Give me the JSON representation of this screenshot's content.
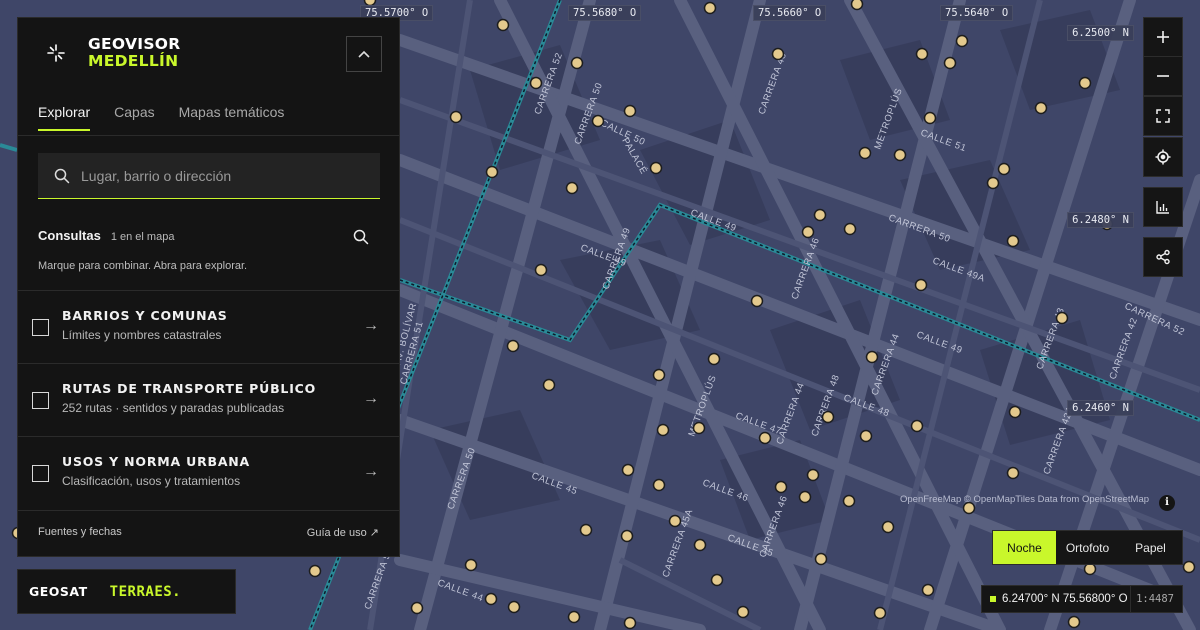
{
  "app": {
    "title_line1": "GEOVISOR",
    "title_line2": "MEDELLÍN",
    "collapse_icon": "chevron-up-icon"
  },
  "tabs": [
    {
      "label": "Explorar",
      "active": true
    },
    {
      "label": "Capas",
      "active": false
    },
    {
      "label": "Mapas temáticos",
      "active": false
    }
  ],
  "search": {
    "placeholder": "Lugar, barrio o dirección",
    "value": ""
  },
  "consultas": {
    "title": "Consultas",
    "count": "1 en el mapa",
    "help": "Marque para combinar. Abra para explorar."
  },
  "layers": [
    {
      "title": "BARRIOS Y COMUNAS",
      "subtitle": "Límites y nombres catastrales",
      "checked": false
    },
    {
      "title": "RUTAS DE TRANSPORTE PÚBLICO",
      "subtitle": "252 rutas · sentidos y paradas publicadas",
      "checked": false
    },
    {
      "title": "USOS Y NORMA URBANA",
      "subtitle": "Clasificación, usos y tratamientos",
      "checked": false
    }
  ],
  "footer": {
    "sources": "Fuentes y fechas",
    "guide": "Guía de uso ↗"
  },
  "logos": {
    "geosat": "GEOSAT",
    "terraes": "TERRAES."
  },
  "map": {
    "lon_labels": [
      "75.5700° O",
      "75.5680° O",
      "75.5660° O",
      "75.5640° O"
    ],
    "lat_labels": [
      "6.2500° N",
      "6.2480° N",
      "6.2460° N"
    ],
    "street_labels": [
      "CARRERA 52",
      "CARRERA 50",
      "CALLE 50",
      "PALACÉ",
      "CARRERA 48",
      "METROPLÚS",
      "CALLE 51",
      "CALLE 49",
      "CALLE 49",
      "CARRERA 49",
      "CARRERA 50",
      "CALLE 49A",
      "CARRERA 52",
      "CARRERA 46",
      "CALLE 49",
      "CARRERA 44",
      "CARRERA 43",
      "CARRERA 42",
      "CALLE 48",
      "CARRERA 44",
      "CARRERA 42A",
      "METROPLÚS",
      "CALLE 47",
      "CARRERA 48",
      "CALLE 46",
      "CALLE 45",
      "CARRERA 50",
      "CARRERA 45A",
      "CALLE 45",
      "CARRERA 46",
      "CALLE 44",
      "AV. BOLÍVAR",
      "CARRERA 51",
      "CARRERA 54"
    ],
    "colors": {
      "background": "#3f4668",
      "street": "#59607f",
      "metro_line": "#2fa7b4",
      "stop": "#e3c98d",
      "accent": "#c9f72b"
    }
  },
  "controls": {
    "zoom_in_icon": "plus-icon",
    "zoom_out_icon": "minus-icon",
    "fullscreen_icon": "fullscreen-icon",
    "locate_icon": "locate-icon",
    "chart_icon": "bar-chart-icon",
    "share_icon": "share-icon"
  },
  "attribution": "OpenFreeMap © OpenMapTiles Data from OpenStreetMap",
  "info_label": "i",
  "basemaps": [
    {
      "label": "Noche",
      "active": true
    },
    {
      "label": "Ortofoto",
      "active": false
    },
    {
      "label": "Papel",
      "active": false
    }
  ],
  "readout": {
    "coords": "6.24700° N 75.56800° O",
    "scale": "1:4487"
  }
}
